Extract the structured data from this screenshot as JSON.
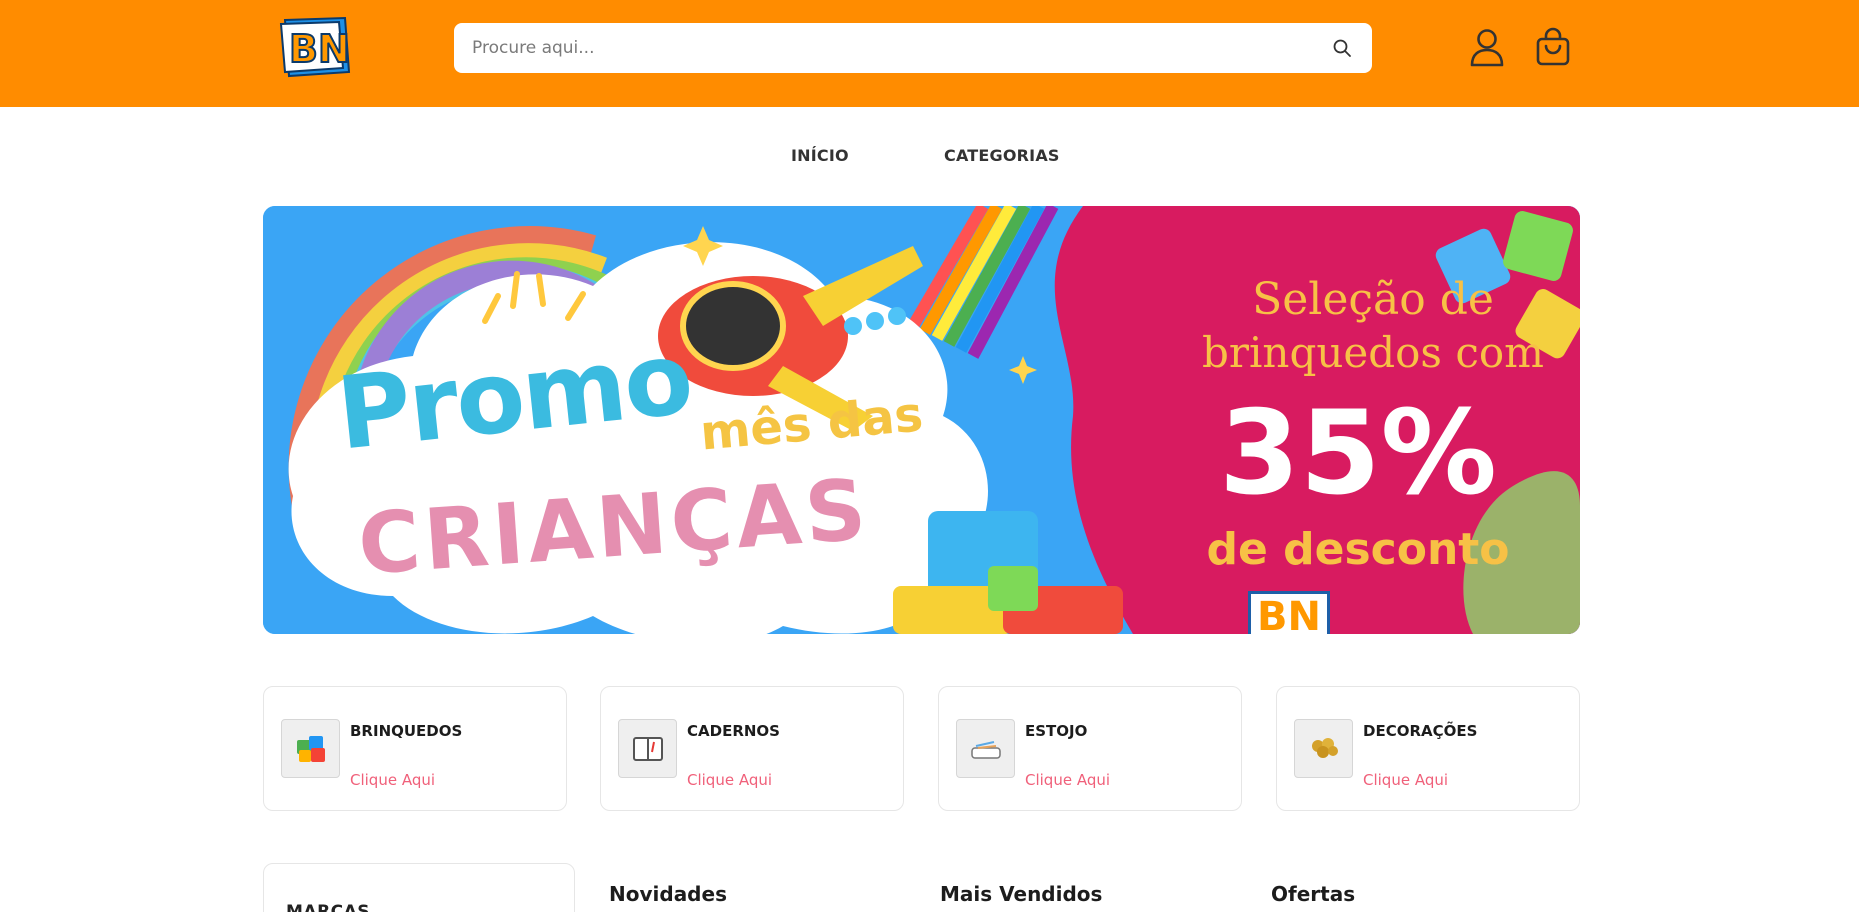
{
  "header": {
    "logo_text": "BN",
    "search_placeholder": "Procure aqui...",
    "search_value": ""
  },
  "nav": {
    "items": [
      {
        "label": "INÍCIO"
      },
      {
        "label": "CATEGORIAS"
      }
    ]
  },
  "banner": {
    "promo_word": "Promo",
    "subtitle_1": "mês das",
    "subtitle_2": "CRIANÇAS",
    "offer_line_1": "Seleção de",
    "offer_line_2": "brinquedos com",
    "discount": "35%",
    "discount_label": "de desconto",
    "logo_text": "BN"
  },
  "categories": [
    {
      "title": "BRINQUEDOS",
      "link": "Clique Aqui",
      "icon": "toy-blocks-icon"
    },
    {
      "title": "CADERNOS",
      "link": "Clique Aqui",
      "icon": "notebook-icon"
    },
    {
      "title": "ESTOJO",
      "link": "Clique Aqui",
      "icon": "pencil-case-icon"
    },
    {
      "title": "DECORAÇÕES",
      "link": "Clique Aqui",
      "icon": "balloons-icon"
    }
  ],
  "sections": {
    "brands": "MARCAS",
    "new": "Novidades",
    "best_sellers": "Mais Vendidos",
    "offers": "Ofertas"
  },
  "colors": {
    "header_bg": "#ff8c00",
    "banner_blue": "#3aa5f5",
    "banner_pink": "#d81b60",
    "link_pink": "#f0607a"
  }
}
